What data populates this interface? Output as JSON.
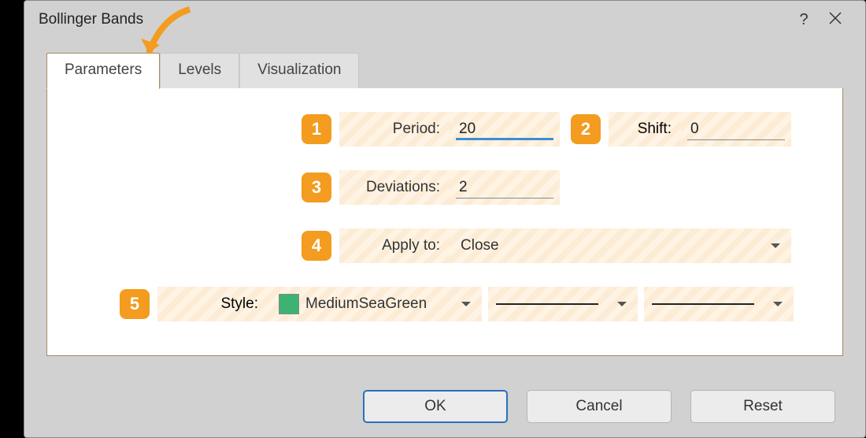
{
  "window_title": "Bollinger Bands",
  "tabs": [
    "Parameters",
    "Levels",
    "Visualization"
  ],
  "badges": {
    "b1": "1",
    "b2": "2",
    "b3": "3",
    "b4": "4",
    "b5": "5"
  },
  "period_label": "Period:",
  "period_value": "20",
  "shift_label": "Shift:",
  "shift_value": "0",
  "deviations_label": "Deviations:",
  "deviations_value": "2",
  "apply_label": "Apply to:",
  "apply_value": "Close",
  "style_label": "Style:",
  "style_color_name": "MediumSeaGreen",
  "ok_label": "OK",
  "cancel_label": "Cancel",
  "reset_label": "Reset"
}
